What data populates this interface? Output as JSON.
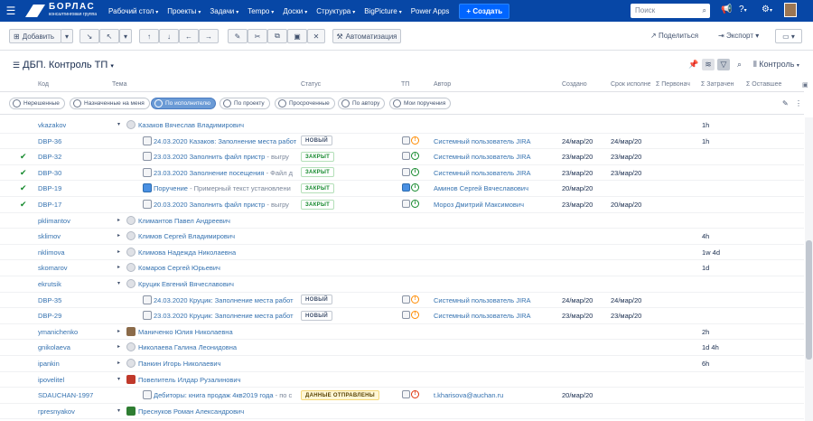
{
  "nav": {
    "logo_name": "БОРЛАС",
    "logo_sub": "консалтинговая группа",
    "items": [
      "Рабочий стол",
      "Проекты",
      "Задачи",
      "Tempo",
      "Доски",
      "Структура",
      "BigPicture",
      "Power Apps"
    ],
    "create_label": "+ Создать",
    "search_placeholder": "Поиск"
  },
  "toolbar": {
    "add_label": "Добавить",
    "automation_label": "Автоматизация",
    "share_label": "Поделиться",
    "export_label": "Экспорт"
  },
  "view": {
    "title": "ДБП. Контроль ТП",
    "control_label": "Контроль"
  },
  "columns": [
    "Код",
    "Тема",
    "Статус",
    "ТП",
    "Автор",
    "Создано",
    "Срок исполне",
    "Σ Первонач",
    "Σ Затрачен",
    "Σ Оставшее"
  ],
  "filters": [
    "Нерешенные",
    "Назначенные на меня",
    "По исполнителю",
    "По проекту",
    "Просроченные",
    "По автору",
    "Мои поручения"
  ],
  "rows": [
    {
      "code": "vkazakov",
      "summary": "Казаков Вячеслав Владимирович",
      "spent": "1h"
    },
    {
      "code": "DBP-36",
      "summary": "24.03.2020 Казаков: Заполнение места работ",
      "status": "НОВЫЙ",
      "author": "Системный пользователь JIRA",
      "created": "24/мар/20",
      "due": "24/мар/20",
      "spent": "1h"
    },
    {
      "code": "DBP-32",
      "summary": "23.03.2020 Заполнить файл пристр",
      "suffix": "- выгру",
      "status": "ЗАКРЫТ",
      "author": "Системный пользователь JIRA",
      "created": "23/мар/20",
      "due": "23/мар/20"
    },
    {
      "code": "DBP-30",
      "summary": "23.03.2020 Заполнение посещения",
      "suffix": "- Файл д",
      "status": "ЗАКРЫТ",
      "author": "Системный пользователь JIRA",
      "created": "23/мар/20",
      "due": "23/мар/20"
    },
    {
      "code": "DBP-19",
      "summary": "Поручение",
      "suffix": "- Примерный текст установлени",
      "status": "ЗАКРЫТ",
      "author": "Аминов Сергей Вячеславович",
      "created": "20/мар/20"
    },
    {
      "code": "DBP-17",
      "summary": "20.03.2020 Заполнить файл пристр",
      "suffix": "- выгру",
      "status": "ЗАКРЫТ",
      "author": "Мороз Дмитрий Максимович",
      "created": "23/мар/20",
      "due": "20/мар/20"
    },
    {
      "code": "pklimantov",
      "summary": "Климантов Павел Андреевич"
    },
    {
      "code": "sklimov",
      "summary": "Климов Сергей Владимирович",
      "spent": "4h"
    },
    {
      "code": "nklimova",
      "summary": "Климова Надежда Николаевна",
      "spent": "1w 4d"
    },
    {
      "code": "skomarov",
      "summary": "Комаров Сергей Юрьевич",
      "spent": "1d"
    },
    {
      "code": "ekrutsik",
      "summary": "Круцик Евгений Вячеславович"
    },
    {
      "code": "DBP-35",
      "summary": "24.03.2020 Круцик: Заполнение места работ",
      "status": "НОВЫЙ",
      "author": "Системный пользователь JIRA",
      "created": "24/мар/20",
      "due": "24/мар/20"
    },
    {
      "code": "DBP-29",
      "summary": "23.03.2020 Круцик: Заполнение места работ",
      "status": "НОВЫЙ",
      "author": "Системный пользователь JIRA",
      "created": "23/мар/20",
      "due": "23/мар/20"
    },
    {
      "code": "ymanichenko",
      "summary": "Маниченко Юлия Николаевна",
      "spent": "2h"
    },
    {
      "code": "gnikolaeva",
      "summary": "Николаева Галина Леонидовна",
      "spent": "1d 4h"
    },
    {
      "code": "ipankin",
      "summary": "Панкин Игорь Николаевич",
      "spent": "6h"
    },
    {
      "code": "ipovelitel",
      "summary": "Повелитель Илдар Рузалинович"
    },
    {
      "code": "SDAUCHAN-1997",
      "summary": "Дебиторы: книга продаж 4кв2019 года",
      "suffix": "- по с",
      "status": "ДАННЫЕ ОТПРАВЛЕНЫ",
      "author": "t.kharisova@auchan.ru",
      "created": "20/мар/20"
    },
    {
      "code": "rpresnyakov",
      "summary": "Преснуков Роман Александрович"
    }
  ]
}
